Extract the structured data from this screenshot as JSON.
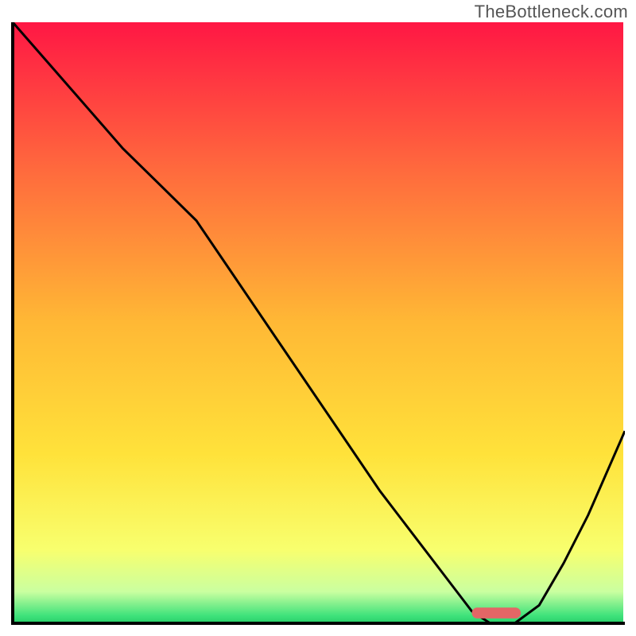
{
  "watermark": "TheBottleneck.com",
  "colors": {
    "gradient_stops": [
      {
        "offset": "0%",
        "color": "#ff1744"
      },
      {
        "offset": "25%",
        "color": "#ff6b3d"
      },
      {
        "offset": "50%",
        "color": "#ffb835"
      },
      {
        "offset": "72%",
        "color": "#ffe23a"
      },
      {
        "offset": "88%",
        "color": "#f8ff6e"
      },
      {
        "offset": "95%",
        "color": "#caffa0"
      },
      {
        "offset": "99%",
        "color": "#3fe27b"
      },
      {
        "offset": "100%",
        "color": "#2dd46e"
      }
    ],
    "curve": "#000000",
    "axis": "#000000",
    "marker": "#e36666"
  },
  "chart_data": {
    "type": "line",
    "title": "",
    "xlabel": "",
    "ylabel": "",
    "xlim": [
      0,
      100
    ],
    "ylim": [
      0,
      100
    ],
    "grid": false,
    "legend": false,
    "x": [
      0,
      6,
      12,
      18,
      24,
      30,
      36,
      42,
      48,
      54,
      60,
      66,
      72,
      75,
      78,
      82,
      86,
      90,
      94,
      100
    ],
    "values": [
      100,
      93,
      86,
      79,
      73,
      67,
      58,
      49,
      40,
      31,
      22,
      14,
      6,
      2,
      0,
      0,
      3,
      10,
      18,
      32
    ],
    "marker": {
      "x_start": 75,
      "x_end": 83,
      "y": 0.8,
      "height": 1.8
    }
  }
}
